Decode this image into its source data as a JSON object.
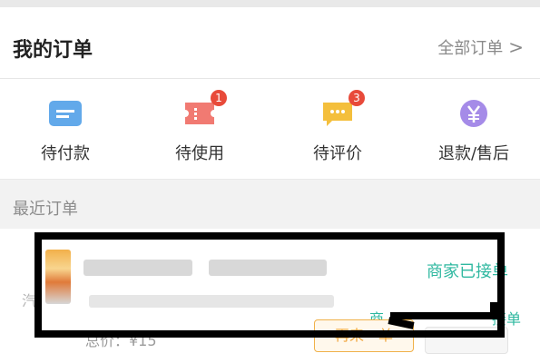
{
  "header": {
    "title": "我的订单",
    "all_orders_label": "全部订单",
    "all_orders_chevron": ">"
  },
  "status_items": [
    {
      "label": "待付款",
      "icon": "wallet-icon",
      "color": "#62a9ea",
      "badge": ""
    },
    {
      "label": "待使用",
      "icon": "ticket-icon",
      "color": "#f17a72",
      "badge": "1"
    },
    {
      "label": "待评价",
      "icon": "comment-icon",
      "color": "#f4bf3c",
      "badge": "3"
    },
    {
      "label": "退款/售后",
      "icon": "yen-refund-icon",
      "color": "#a58be8",
      "badge": ""
    }
  ],
  "recent": {
    "title": "最近订单"
  },
  "order": {
    "status": "商家已接单",
    "status_partial_a": "商",
    "status_partial_b": "接单",
    "total_price": "总价：¥15",
    "again_button": "再来一单",
    "side_mark": "汽"
  },
  "colors": {
    "accent_teal": "#2fb8a0",
    "badge_red": "#e84a3a",
    "button_orange": "#f0a43a"
  }
}
